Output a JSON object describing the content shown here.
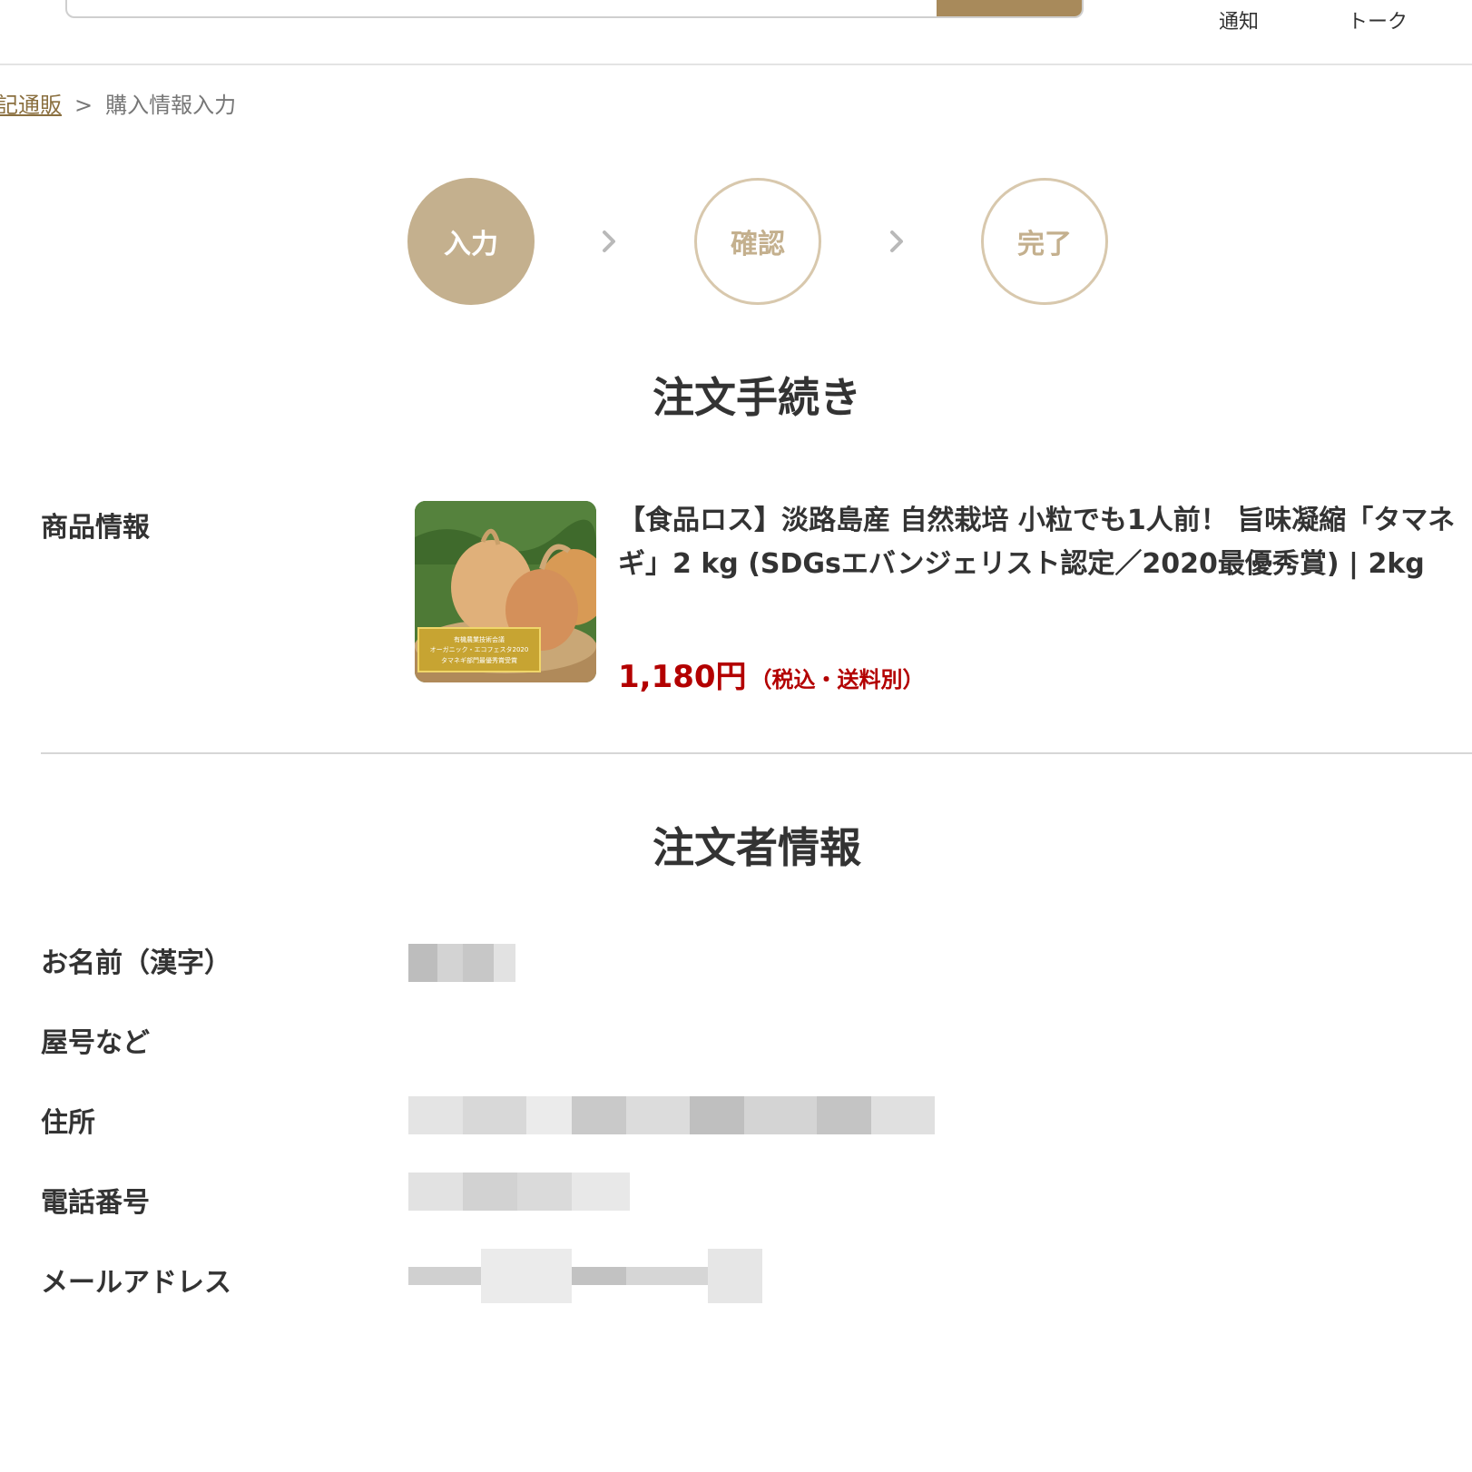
{
  "header": {
    "search_placeholder": "",
    "nav": {
      "notify": "通知",
      "talk": "トーク"
    }
  },
  "breadcrumb": {
    "parent": "記通販",
    "separator": ">",
    "current": "購入情報入力"
  },
  "steps": [
    {
      "label": "入力",
      "state": "active"
    },
    {
      "label": "確認",
      "state": "pending"
    },
    {
      "label": "完了",
      "state": "pending"
    }
  ],
  "order_section": {
    "title": "注文手続き",
    "product_label": "商品情報",
    "product": {
      "name": "【食品ロス】淡路島産 自然栽培 小粒でも1人前！ 旨味凝縮「タマネギ」2 kg (SDGsエバンジェリスト認定／2020最優秀賞) | 2kg",
      "price": "1,180円",
      "price_note": "（税込・送料別）",
      "image_badge_lines": [
        "有機農業技術会議",
        "オーガニック・エコフェスタ2020",
        "タマネギ部門最優秀賞受賞"
      ]
    }
  },
  "orderer_section": {
    "title": "注文者情報",
    "fields": [
      {
        "label": "お名前（漢字）",
        "value_masked": true
      },
      {
        "label": "屋号など",
        "value_masked": false
      },
      {
        "label": "住所",
        "value_masked": true
      },
      {
        "label": "電話番号",
        "value_masked": true
      },
      {
        "label": "メールアドレス",
        "value_masked": true
      }
    ]
  },
  "colors": {
    "accent": "#a88a5b",
    "step_active": "#c4b08e",
    "step_border": "#d8c8ad",
    "price": "#b30000",
    "link": "#8a6f3f"
  }
}
